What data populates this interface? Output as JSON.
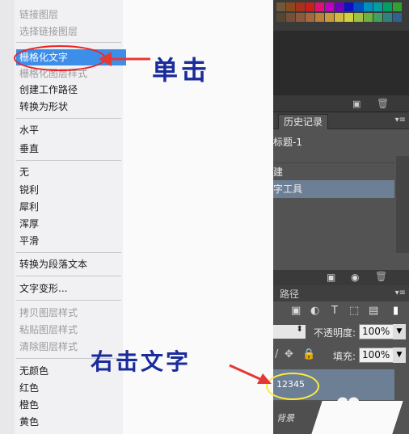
{
  "context_menu": {
    "items": [
      {
        "label": "链接图层",
        "disabled": true
      },
      {
        "label": "选择链接图层",
        "disabled": true
      },
      {
        "label": "栅格化文字",
        "disabled": false,
        "highlighted": true
      },
      {
        "label": "栅格化图层样式",
        "disabled": true
      },
      {
        "label": "创建工作路径",
        "disabled": false
      },
      {
        "label": "转换为形状",
        "disabled": false
      },
      {
        "label": "水平",
        "disabled": false
      },
      {
        "label": "垂直",
        "disabled": false
      },
      {
        "label": "无",
        "disabled": false
      },
      {
        "label": "锐利",
        "disabled": false
      },
      {
        "label": "犀利",
        "disabled": false
      },
      {
        "label": "浑厚",
        "disabled": false
      },
      {
        "label": "平滑",
        "disabled": false
      },
      {
        "label": "转换为段落文本",
        "disabled": false
      },
      {
        "label": "文字变形...",
        "disabled": false
      },
      {
        "label": "拷贝图层样式",
        "disabled": true
      },
      {
        "label": "粘贴图层样式",
        "disabled": true
      },
      {
        "label": "清除图层样式",
        "disabled": true
      },
      {
        "label": "无颜色",
        "disabled": false
      },
      {
        "label": "红色",
        "disabled": false
      },
      {
        "label": "橙色",
        "disabled": false
      },
      {
        "label": "黄色",
        "disabled": false
      }
    ],
    "highlight_color": "#3d8ee8"
  },
  "history": {
    "tab_label": "历史记录",
    "snapshot_label": "标题-1",
    "rows": [
      "建",
      "字工具"
    ],
    "menu_icon": "panel-menu-icon"
  },
  "layers": {
    "tab_label": "路径",
    "opacity_label": "不透明度:",
    "opacity_value": "100%",
    "fill_label": "填充:",
    "fill_value": "100%",
    "text_layer_name": "12345",
    "background_layer_name": "背景"
  },
  "annotations": {
    "click_caption": "单击",
    "right_click_caption": "右击文字",
    "arrow_color": "#e53935",
    "caption_color": "#1a2c9a"
  },
  "swatch_colors": [
    [
      "#6e5a3a",
      "#8a4a1e",
      "#a6321e",
      "#c81e1e",
      "#e0107a",
      "#c000c0",
      "#7000c0",
      "#1010c0",
      "#0050c0",
      "#0090c0",
      "#00a0a0",
      "#00a060",
      "#30a030"
    ],
    [
      "#564634",
      "#74503a",
      "#8a5a3c",
      "#a4683c",
      "#b8803a",
      "#c89a3a",
      "#d4b840",
      "#d0d040",
      "#a0c040",
      "#70b040",
      "#40a060",
      "#308080",
      "#306090"
    ]
  ]
}
